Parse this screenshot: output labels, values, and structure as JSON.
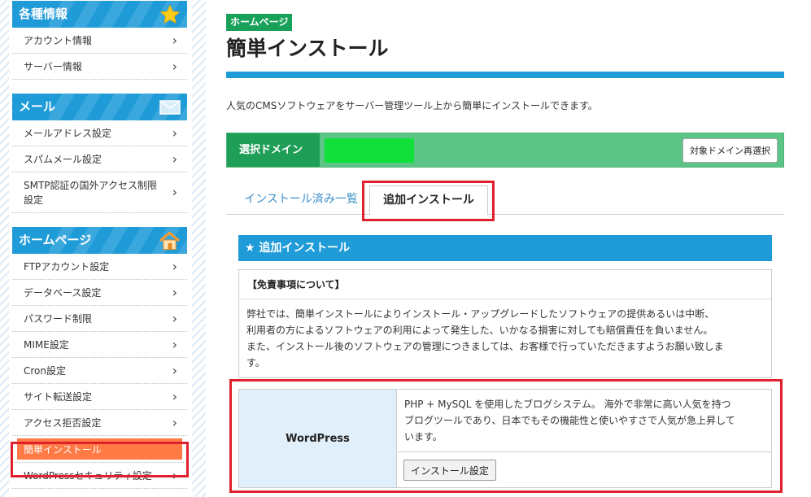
{
  "sidebar": {
    "sections": [
      {
        "title": "各種情報",
        "icon": "star-icon",
        "items": [
          "アカウント情報",
          "サーバー情報"
        ]
      },
      {
        "title": "メール",
        "icon": "mail-icon",
        "items": [
          "メールアドレス設定",
          "スパムメール設定",
          "SMTP認証の国外アクセス制限設定"
        ]
      },
      {
        "title": "ホームページ",
        "icon": "house-icon",
        "items": [
          "FTPアカウント設定",
          "データベース設定",
          "パスワード制限",
          "MIME設定",
          "Cron設定",
          "サイト転送設定",
          "アクセス拒否設定",
          "簡単インストール",
          "WordPressセキュリティ設定"
        ]
      }
    ],
    "smtp_line1": "SMTP認証の国外アクセス制限",
    "smtp_line2": "設定",
    "active_item": "簡単インストール"
  },
  "main": {
    "badge": "ホームページ",
    "title": "簡単インストール",
    "description": "人気のCMSソフトウェアをサーバー管理ツール上から簡単にインストールできます。",
    "domain_label": "選択ドメイン",
    "reselect_button": "対象ドメイン再選択",
    "tabs": [
      "インストール済み一覧",
      "追加インストール"
    ],
    "active_tab": "追加インストール",
    "section_title": "追加インストール",
    "disclaimer_title": "【免責事項について】",
    "disclaimer_lines": [
      "弊社では、簡単インストールによりインストール・アップグレードしたソフトウェアの提供あるいは中断、",
      "利用者の方によるソフトウェアの利用によって発生した、いかなる損害に対しても賠償責任を負いません。",
      "また、インストール後のソフトウェアの管理につきましては、お客様で行っていただきますようお願い致しま",
      "す。"
    ],
    "software": {
      "name": "WordPress",
      "desc_lines": [
        "PHP + MySQL を使用したブログシステム。 海外で非常に高い人気を持つ",
        "ブログツールであり、日本でもその機能性と使いやすさで人気が急上昇して",
        "います。"
      ],
      "install_button": "インストール設定"
    }
  },
  "colors": {
    "accent_blue": "#1f9bd8",
    "badge_green": "#19a15a",
    "domain_bar_green": "#5cc486",
    "active_item_orange": "#ff7a45",
    "highlight_red": "#e0202c"
  }
}
